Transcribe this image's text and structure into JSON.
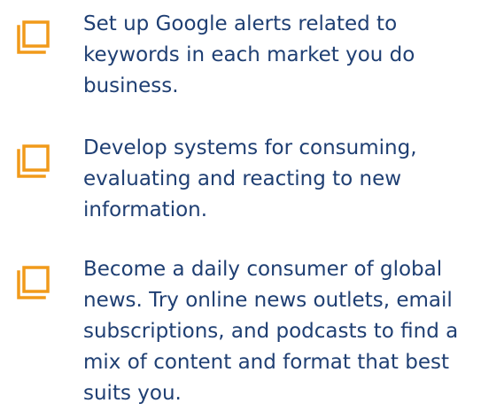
{
  "colors": {
    "text": "#1f3f73",
    "accent": "#f19a1a"
  },
  "icons": {
    "checkbox": "square-stack-icon"
  },
  "items": [
    {
      "text": "Set up Google alerts related to keywords in each market you do business."
    },
    {
      "text": "Develop systems for consuming, evaluating and reacting to new information."
    },
    {
      "text": "Become a daily consumer of global news. Try online news outlets, email subscriptions, and podcasts to find a mix of content and format that best suits you."
    }
  ]
}
